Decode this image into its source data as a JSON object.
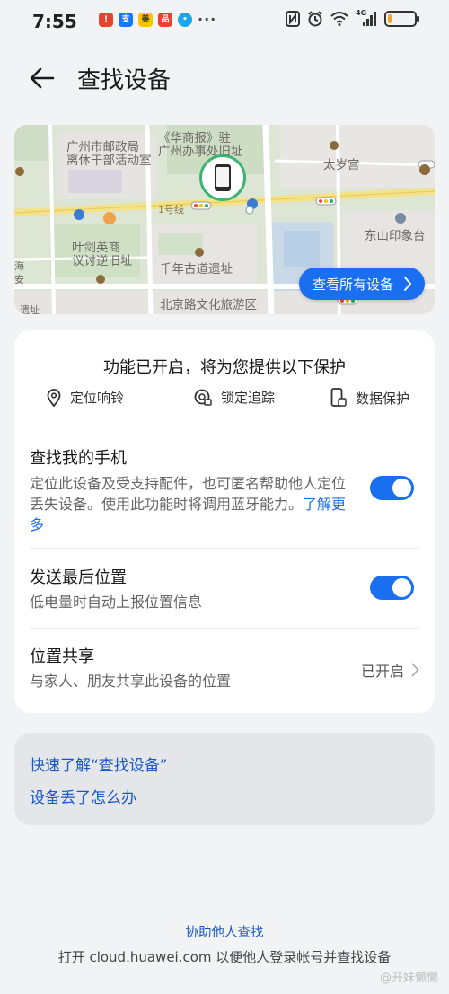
{
  "status_bar": {
    "time": "7:55",
    "notifications": [
      {
        "icon": "app-red-icon",
        "color": "#e8432f"
      },
      {
        "icon": "alipay-icon",
        "color": "#1677ff"
      },
      {
        "icon": "meituan-icon",
        "color": "#ffc300"
      },
      {
        "icon": "app-red-2-icon",
        "color": "#e8432f"
      },
      {
        "icon": "chat-bubble-icon",
        "color": "#1aa6e8"
      }
    ],
    "more": "···",
    "network": "4G",
    "battery_level": 0.15,
    "battery_color": "#f5a623"
  },
  "header": {
    "title": "查找设备"
  },
  "map": {
    "labels": {
      "post_bureau": "广州市邮政局\n离休干部活动室",
      "huashangbao": "《华商报》驻\n广州办事处旧址",
      "taisui": "太岁宫",
      "yide": "叶剑英商\n议讨逆旧址",
      "qiannian": "千年古道遗址",
      "beijinglu": "北京路文化旅游区",
      "dongshan": "东山印象台",
      "line1": "1号线",
      "edge_left": "海\n安",
      "edge_bottom": "遗址"
    },
    "view_all_button": "查看所有设备"
  },
  "protection": {
    "headline": "功能已开启，将为您提供以下保护",
    "features": [
      "定位响铃",
      "锁定追踪",
      "数据保护"
    ]
  },
  "find_my_phone": {
    "title": "查找我的手机",
    "description": "定位此设备及受支持配件，也可匿名帮助他人定位丢失设备。使用此功能时将调用蓝牙能力。",
    "learn_more": "了解更多",
    "enabled": true
  },
  "send_last_location": {
    "title": "发送最后位置",
    "description": "低电量时自动上报位置信息",
    "enabled": true
  },
  "location_sharing": {
    "title": "位置共享",
    "description": "与家人、朋友共享此设备的位置",
    "status": "已开启"
  },
  "help_links": [
    "快速了解“查找设备”",
    "设备丢了怎么办"
  ],
  "footer": {
    "link": "协助他人查找",
    "text": "打开 cloud.huawei.com 以便他人登录帐号并查找设备"
  },
  "watermark": "@开妹懒懒",
  "colors": {
    "accent": "#1a6ff0",
    "link": "#1a58c9",
    "background": "#f1f3f5"
  }
}
